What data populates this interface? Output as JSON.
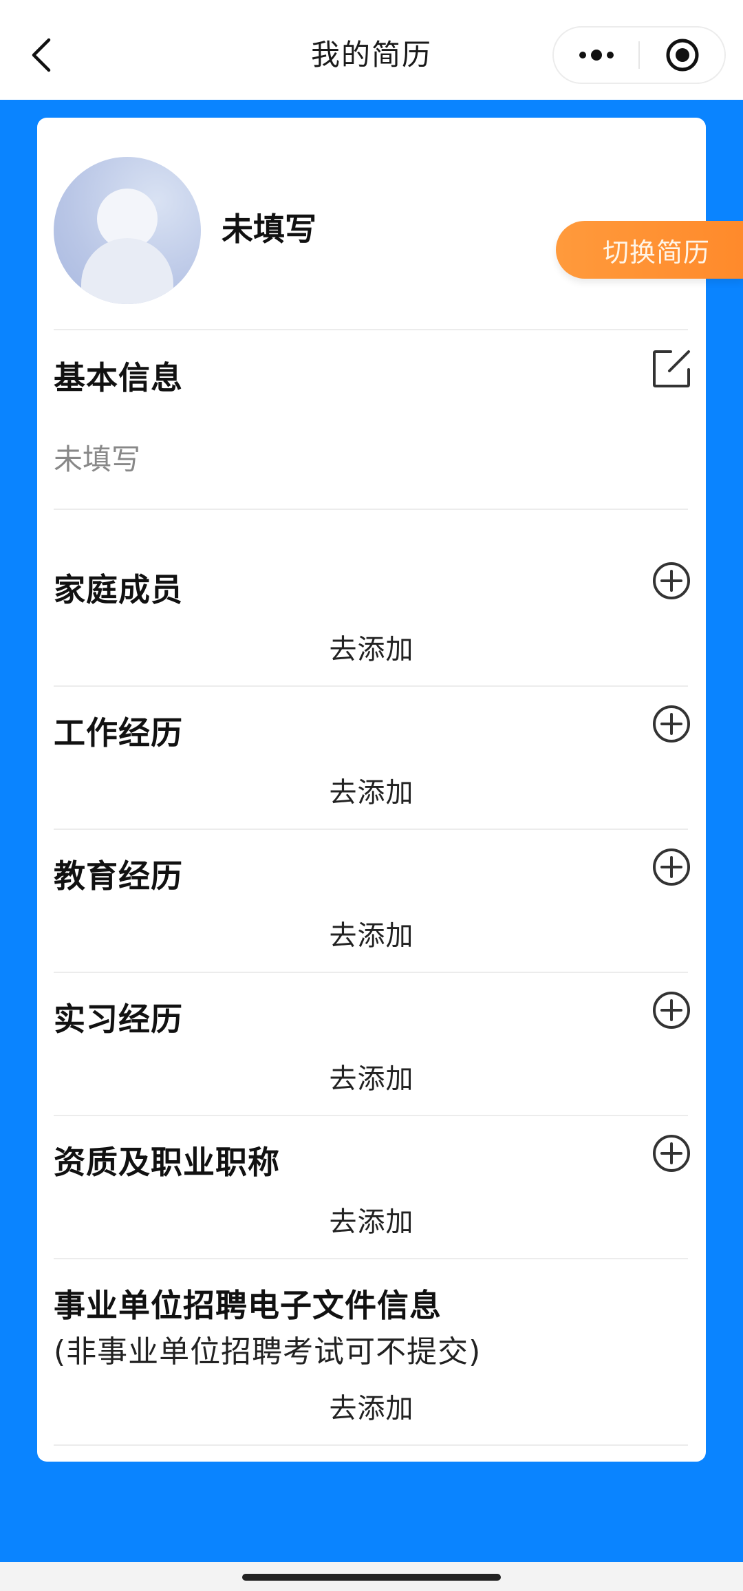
{
  "navbar": {
    "title": "我的简历",
    "back_icon": "chevron-left-icon",
    "more_icon": "more-dots-icon",
    "target_icon": "record-target-icon"
  },
  "profile": {
    "name": "未填写",
    "switch_label": "切换简历"
  },
  "basic_info": {
    "title": "基本信息",
    "value": "未填写",
    "icon": "edit-icon"
  },
  "sections": [
    {
      "title": "家庭成员",
      "add_label": "去添加",
      "icon": "plus-circle-icon"
    },
    {
      "title": "工作经历",
      "add_label": "去添加",
      "icon": "plus-circle-icon"
    },
    {
      "title": "教育经历",
      "add_label": "去添加",
      "icon": "plus-circle-icon"
    },
    {
      "title": "实习经历",
      "add_label": "去添加",
      "icon": "plus-circle-icon"
    },
    {
      "title": "资质及职业职称",
      "add_label": "去添加",
      "icon": "plus-circle-icon"
    }
  ],
  "files_section": {
    "title": "事业单位招聘电子文件信息",
    "subtitle": "(非事业单位招聘考试可不提交)",
    "add_label": "去添加"
  },
  "colors": {
    "background": "#0a84ff",
    "accent_orange": "#ff8a2b",
    "card": "#ffffff"
  }
}
